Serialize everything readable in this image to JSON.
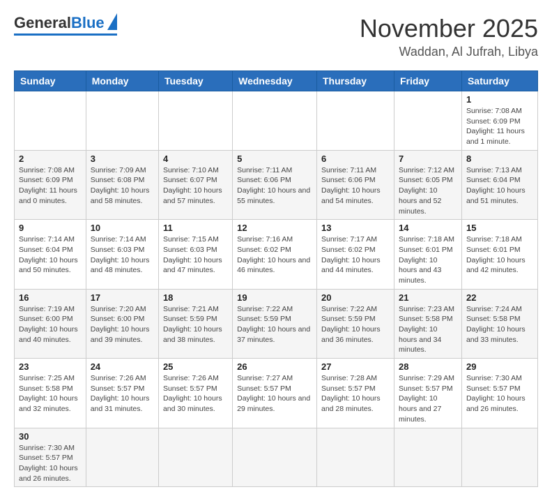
{
  "logo": {
    "general": "General",
    "blue": "Blue"
  },
  "title": {
    "month": "November 2025",
    "location": "Waddan, Al Jufrah, Libya"
  },
  "weekdays": [
    "Sunday",
    "Monday",
    "Tuesday",
    "Wednesday",
    "Thursday",
    "Friday",
    "Saturday"
  ],
  "weeks": [
    [
      null,
      null,
      null,
      null,
      null,
      null,
      {
        "day": 1,
        "sunrise": "7:08 AM",
        "sunset": "6:09 PM",
        "daylight": "11 hours and 1 minute."
      }
    ],
    [
      {
        "day": 2,
        "sunrise": "7:08 AM",
        "sunset": "6:09 PM",
        "daylight": "11 hours and 0 minutes."
      },
      {
        "day": 3,
        "sunrise": "7:09 AM",
        "sunset": "6:08 PM",
        "daylight": "10 hours and 58 minutes."
      },
      {
        "day": 4,
        "sunrise": "7:10 AM",
        "sunset": "6:07 PM",
        "daylight": "10 hours and 57 minutes."
      },
      {
        "day": 5,
        "sunrise": "7:11 AM",
        "sunset": "6:06 PM",
        "daylight": "10 hours and 55 minutes."
      },
      {
        "day": 6,
        "sunrise": "7:11 AM",
        "sunset": "6:06 PM",
        "daylight": "10 hours and 54 minutes."
      },
      {
        "day": 7,
        "sunrise": "7:12 AM",
        "sunset": "6:05 PM",
        "daylight": "10 hours and 52 minutes."
      },
      {
        "day": 8,
        "sunrise": "7:13 AM",
        "sunset": "6:04 PM",
        "daylight": "10 hours and 51 minutes."
      }
    ],
    [
      {
        "day": 9,
        "sunrise": "7:14 AM",
        "sunset": "6:04 PM",
        "daylight": "10 hours and 50 minutes."
      },
      {
        "day": 10,
        "sunrise": "7:14 AM",
        "sunset": "6:03 PM",
        "daylight": "10 hours and 48 minutes."
      },
      {
        "day": 11,
        "sunrise": "7:15 AM",
        "sunset": "6:03 PM",
        "daylight": "10 hours and 47 minutes."
      },
      {
        "day": 12,
        "sunrise": "7:16 AM",
        "sunset": "6:02 PM",
        "daylight": "10 hours and 46 minutes."
      },
      {
        "day": 13,
        "sunrise": "7:17 AM",
        "sunset": "6:02 PM",
        "daylight": "10 hours and 44 minutes."
      },
      {
        "day": 14,
        "sunrise": "7:18 AM",
        "sunset": "6:01 PM",
        "daylight": "10 hours and 43 minutes."
      },
      {
        "day": 15,
        "sunrise": "7:18 AM",
        "sunset": "6:01 PM",
        "daylight": "10 hours and 42 minutes."
      }
    ],
    [
      {
        "day": 16,
        "sunrise": "7:19 AM",
        "sunset": "6:00 PM",
        "daylight": "10 hours and 40 minutes."
      },
      {
        "day": 17,
        "sunrise": "7:20 AM",
        "sunset": "6:00 PM",
        "daylight": "10 hours and 39 minutes."
      },
      {
        "day": 18,
        "sunrise": "7:21 AM",
        "sunset": "5:59 PM",
        "daylight": "10 hours and 38 minutes."
      },
      {
        "day": 19,
        "sunrise": "7:22 AM",
        "sunset": "5:59 PM",
        "daylight": "10 hours and 37 minutes."
      },
      {
        "day": 20,
        "sunrise": "7:22 AM",
        "sunset": "5:59 PM",
        "daylight": "10 hours and 36 minutes."
      },
      {
        "day": 21,
        "sunrise": "7:23 AM",
        "sunset": "5:58 PM",
        "daylight": "10 hours and 34 minutes."
      },
      {
        "day": 22,
        "sunrise": "7:24 AM",
        "sunset": "5:58 PM",
        "daylight": "10 hours and 33 minutes."
      }
    ],
    [
      {
        "day": 23,
        "sunrise": "7:25 AM",
        "sunset": "5:58 PM",
        "daylight": "10 hours and 32 minutes."
      },
      {
        "day": 24,
        "sunrise": "7:26 AM",
        "sunset": "5:57 PM",
        "daylight": "10 hours and 31 minutes."
      },
      {
        "day": 25,
        "sunrise": "7:26 AM",
        "sunset": "5:57 PM",
        "daylight": "10 hours and 30 minutes."
      },
      {
        "day": 26,
        "sunrise": "7:27 AM",
        "sunset": "5:57 PM",
        "daylight": "10 hours and 29 minutes."
      },
      {
        "day": 27,
        "sunrise": "7:28 AM",
        "sunset": "5:57 PM",
        "daylight": "10 hours and 28 minutes."
      },
      {
        "day": 28,
        "sunrise": "7:29 AM",
        "sunset": "5:57 PM",
        "daylight": "10 hours and 27 minutes."
      },
      {
        "day": 29,
        "sunrise": "7:30 AM",
        "sunset": "5:57 PM",
        "daylight": "10 hours and 26 minutes."
      }
    ],
    [
      {
        "day": 30,
        "sunrise": "7:30 AM",
        "sunset": "5:57 PM",
        "daylight": "10 hours and 26 minutes."
      },
      null,
      null,
      null,
      null,
      null,
      null
    ]
  ]
}
